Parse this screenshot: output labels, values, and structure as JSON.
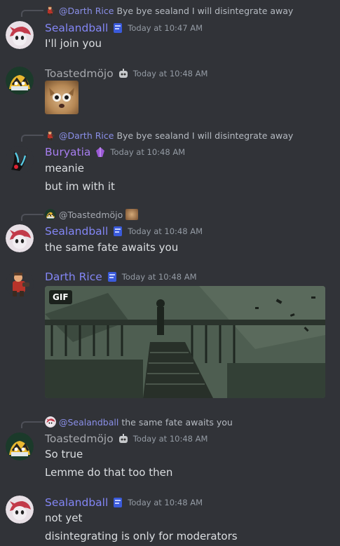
{
  "messages": [
    {
      "reply": {
        "name": "@Darth Rice",
        "text": "Bye bye sealand I will disintegrate away"
      },
      "author": "Sealandball",
      "time": "Today at 10:47 AM",
      "lines": [
        "I'll join you"
      ]
    },
    {
      "author": "Toastedmöjo",
      "time": "Today at 10:48 AM",
      "lines": []
    },
    {
      "reply": {
        "name": "@Darth Rice",
        "text": "Bye bye sealand I will disintegrate away"
      },
      "author": "Buryatia",
      "time": "Today at 10:48 AM",
      "lines": [
        "meanie",
        "but im with it"
      ]
    },
    {
      "reply": {
        "name": "@Toastedmöjo",
        "text": ""
      },
      "author": "Sealandball",
      "time": "Today at 10:48 AM",
      "lines": [
        "the same fate awaits you"
      ]
    },
    {
      "author": "Darth Rice",
      "time": "Today at 10:48 AM",
      "gif_label": "GIF",
      "lines": []
    },
    {
      "reply": {
        "name": "@Sealandball",
        "text": "the same fate awaits you"
      },
      "author": "Toastedmöjo",
      "time": "Today at 10:48 AM",
      "lines": [
        "So true",
        "Lemme do that too then"
      ]
    },
    {
      "author": "Sealandball",
      "time": "Today at 10:48 AM",
      "lines": [
        "not yet",
        "disintegrating is only for moderators"
      ]
    }
  ],
  "icons": {
    "sealand_avatar": "sealand-avatar",
    "toasted_avatar": "toasted-avatar",
    "buryatia_avatar": "buryatia-avatar",
    "darth_avatar": "darth-avatar"
  },
  "colors": {
    "background": "#313338",
    "username_blue": "#8386f5",
    "username_gray": "#a6a8ad",
    "username_purple": "#a77ef0",
    "timestamp": "#949ba4"
  }
}
